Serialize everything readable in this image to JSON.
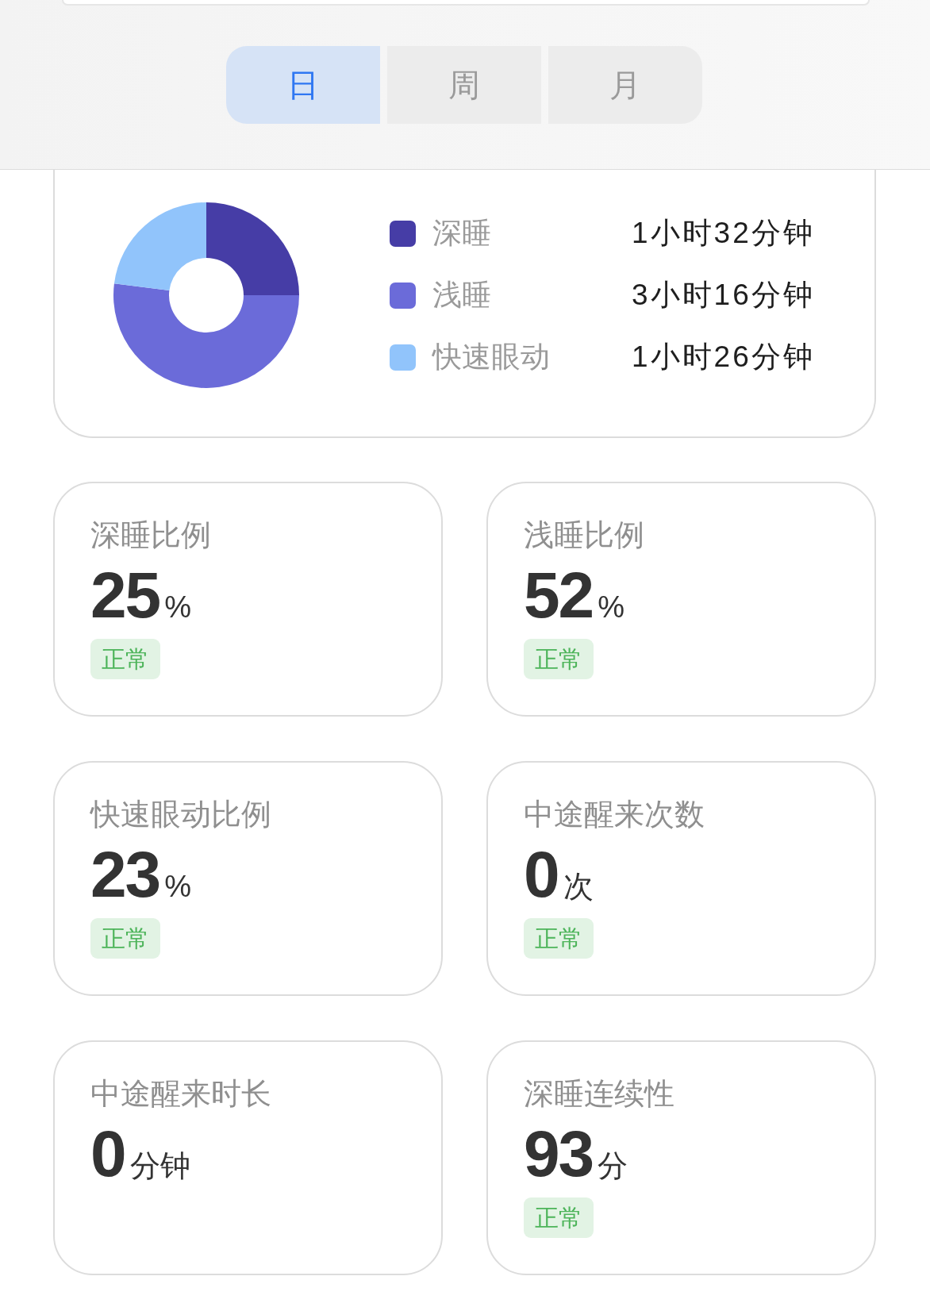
{
  "tabs": [
    {
      "label": "日",
      "selected": true
    },
    {
      "label": "周",
      "selected": false
    },
    {
      "label": "月",
      "selected": false
    }
  ],
  "sleep_chart": {
    "chart_data": {
      "type": "donut",
      "categories": [
        "深睡",
        "浅睡",
        "快速眼动"
      ],
      "values": [
        25,
        52,
        23
      ]
    },
    "legend": [
      {
        "color": "#463da6",
        "duration": "1小时32分钟"
      },
      {
        "color": "#6b6bd9",
        "duration": "3小时16分钟"
      },
      {
        "color": "#91c4fb",
        "duration": "1小时26分钟"
      }
    ]
  },
  "stats": [
    {
      "title": "深睡比例",
      "value": "25",
      "unit": "%",
      "status": "正常"
    },
    {
      "title": "浅睡比例",
      "value": "52",
      "unit": "%",
      "status": "正常"
    },
    {
      "title": "快速眼动比例",
      "value": "23",
      "unit": "%",
      "status": "正常"
    },
    {
      "title": "中途醒来次数",
      "value": "0",
      "unit": "次",
      "status": "正常"
    },
    {
      "title": "中途醒来时长",
      "value": "0",
      "unit": "分钟"
    },
    {
      "title": "深睡连续性",
      "value": "93",
      "unit": "分",
      "status": "正常"
    }
  ]
}
